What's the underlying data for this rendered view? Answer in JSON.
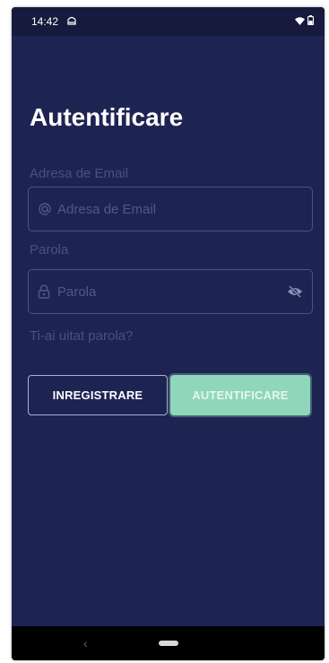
{
  "statusbar": {
    "time": "14:42",
    "notification_icon": "android-debug-icon",
    "wifi_icon": "wifi-icon",
    "battery_icon": "battery-icon"
  },
  "screen": {
    "title": "Autentificare"
  },
  "email": {
    "label": "Adresa de Email",
    "placeholder": "Adresa de Email",
    "value": "",
    "icon": "at-icon"
  },
  "password": {
    "label": "Parola",
    "placeholder": "Parola",
    "value": "",
    "icon": "lock-icon",
    "toggle_icon": "eye-off-icon"
  },
  "forgot_password": {
    "label": "Ti-ai uitat parola?"
  },
  "buttons": {
    "register_label": "INREGISTRARE",
    "login_label": "AUTENTIFICARE"
  },
  "navbar": {
    "back_icon": "back-chevron-icon",
    "home_icon": "home-pill-icon"
  },
  "colors": {
    "background": "#1e2452",
    "statusbar": "#161b3d",
    "accent": "#8fd7bb",
    "muted_text": "#4a5080",
    "border": "#4b5385"
  }
}
